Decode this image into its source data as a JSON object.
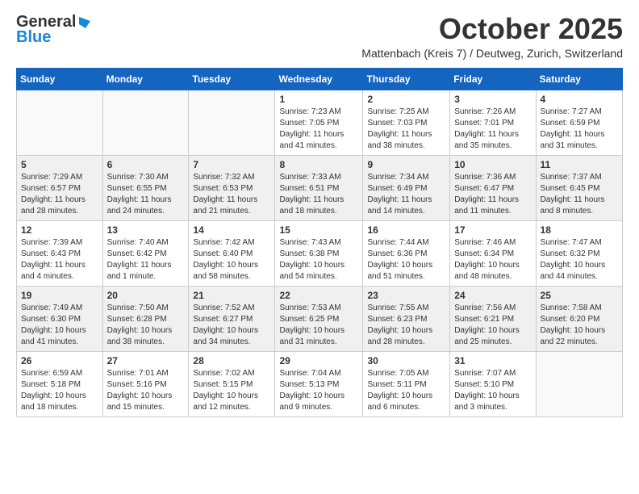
{
  "logo": {
    "line1": "General",
    "line2": "Blue"
  },
  "title": "October 2025",
  "subtitle": "Mattenbach (Kreis 7) / Deutweg, Zurich, Switzerland",
  "weekdays": [
    "Sunday",
    "Monday",
    "Tuesday",
    "Wednesday",
    "Thursday",
    "Friday",
    "Saturday"
  ],
  "weeks": [
    [
      {
        "day": "",
        "info": ""
      },
      {
        "day": "",
        "info": ""
      },
      {
        "day": "",
        "info": ""
      },
      {
        "day": "1",
        "info": "Sunrise: 7:23 AM\nSunset: 7:05 PM\nDaylight: 11 hours\nand 41 minutes."
      },
      {
        "day": "2",
        "info": "Sunrise: 7:25 AM\nSunset: 7:03 PM\nDaylight: 11 hours\nand 38 minutes."
      },
      {
        "day": "3",
        "info": "Sunrise: 7:26 AM\nSunset: 7:01 PM\nDaylight: 11 hours\nand 35 minutes."
      },
      {
        "day": "4",
        "info": "Sunrise: 7:27 AM\nSunset: 6:59 PM\nDaylight: 11 hours\nand 31 minutes."
      }
    ],
    [
      {
        "day": "5",
        "info": "Sunrise: 7:29 AM\nSunset: 6:57 PM\nDaylight: 11 hours\nand 28 minutes."
      },
      {
        "day": "6",
        "info": "Sunrise: 7:30 AM\nSunset: 6:55 PM\nDaylight: 11 hours\nand 24 minutes."
      },
      {
        "day": "7",
        "info": "Sunrise: 7:32 AM\nSunset: 6:53 PM\nDaylight: 11 hours\nand 21 minutes."
      },
      {
        "day": "8",
        "info": "Sunrise: 7:33 AM\nSunset: 6:51 PM\nDaylight: 11 hours\nand 18 minutes."
      },
      {
        "day": "9",
        "info": "Sunrise: 7:34 AM\nSunset: 6:49 PM\nDaylight: 11 hours\nand 14 minutes."
      },
      {
        "day": "10",
        "info": "Sunrise: 7:36 AM\nSunset: 6:47 PM\nDaylight: 11 hours\nand 11 minutes."
      },
      {
        "day": "11",
        "info": "Sunrise: 7:37 AM\nSunset: 6:45 PM\nDaylight: 11 hours\nand 8 minutes."
      }
    ],
    [
      {
        "day": "12",
        "info": "Sunrise: 7:39 AM\nSunset: 6:43 PM\nDaylight: 11 hours\nand 4 minutes."
      },
      {
        "day": "13",
        "info": "Sunrise: 7:40 AM\nSunset: 6:42 PM\nDaylight: 11 hours\nand 1 minute."
      },
      {
        "day": "14",
        "info": "Sunrise: 7:42 AM\nSunset: 6:40 PM\nDaylight: 10 hours\nand 58 minutes."
      },
      {
        "day": "15",
        "info": "Sunrise: 7:43 AM\nSunset: 6:38 PM\nDaylight: 10 hours\nand 54 minutes."
      },
      {
        "day": "16",
        "info": "Sunrise: 7:44 AM\nSunset: 6:36 PM\nDaylight: 10 hours\nand 51 minutes."
      },
      {
        "day": "17",
        "info": "Sunrise: 7:46 AM\nSunset: 6:34 PM\nDaylight: 10 hours\nand 48 minutes."
      },
      {
        "day": "18",
        "info": "Sunrise: 7:47 AM\nSunset: 6:32 PM\nDaylight: 10 hours\nand 44 minutes."
      }
    ],
    [
      {
        "day": "19",
        "info": "Sunrise: 7:49 AM\nSunset: 6:30 PM\nDaylight: 10 hours\nand 41 minutes."
      },
      {
        "day": "20",
        "info": "Sunrise: 7:50 AM\nSunset: 6:28 PM\nDaylight: 10 hours\nand 38 minutes."
      },
      {
        "day": "21",
        "info": "Sunrise: 7:52 AM\nSunset: 6:27 PM\nDaylight: 10 hours\nand 34 minutes."
      },
      {
        "day": "22",
        "info": "Sunrise: 7:53 AM\nSunset: 6:25 PM\nDaylight: 10 hours\nand 31 minutes."
      },
      {
        "day": "23",
        "info": "Sunrise: 7:55 AM\nSunset: 6:23 PM\nDaylight: 10 hours\nand 28 minutes."
      },
      {
        "day": "24",
        "info": "Sunrise: 7:56 AM\nSunset: 6:21 PM\nDaylight: 10 hours\nand 25 minutes."
      },
      {
        "day": "25",
        "info": "Sunrise: 7:58 AM\nSunset: 6:20 PM\nDaylight: 10 hours\nand 22 minutes."
      }
    ],
    [
      {
        "day": "26",
        "info": "Sunrise: 6:59 AM\nSunset: 5:18 PM\nDaylight: 10 hours\nand 18 minutes."
      },
      {
        "day": "27",
        "info": "Sunrise: 7:01 AM\nSunset: 5:16 PM\nDaylight: 10 hours\nand 15 minutes."
      },
      {
        "day": "28",
        "info": "Sunrise: 7:02 AM\nSunset: 5:15 PM\nDaylight: 10 hours\nand 12 minutes."
      },
      {
        "day": "29",
        "info": "Sunrise: 7:04 AM\nSunset: 5:13 PM\nDaylight: 10 hours\nand 9 minutes."
      },
      {
        "day": "30",
        "info": "Sunrise: 7:05 AM\nSunset: 5:11 PM\nDaylight: 10 hours\nand 6 minutes."
      },
      {
        "day": "31",
        "info": "Sunrise: 7:07 AM\nSunset: 5:10 PM\nDaylight: 10 hours\nand 3 minutes."
      },
      {
        "day": "",
        "info": ""
      }
    ]
  ]
}
